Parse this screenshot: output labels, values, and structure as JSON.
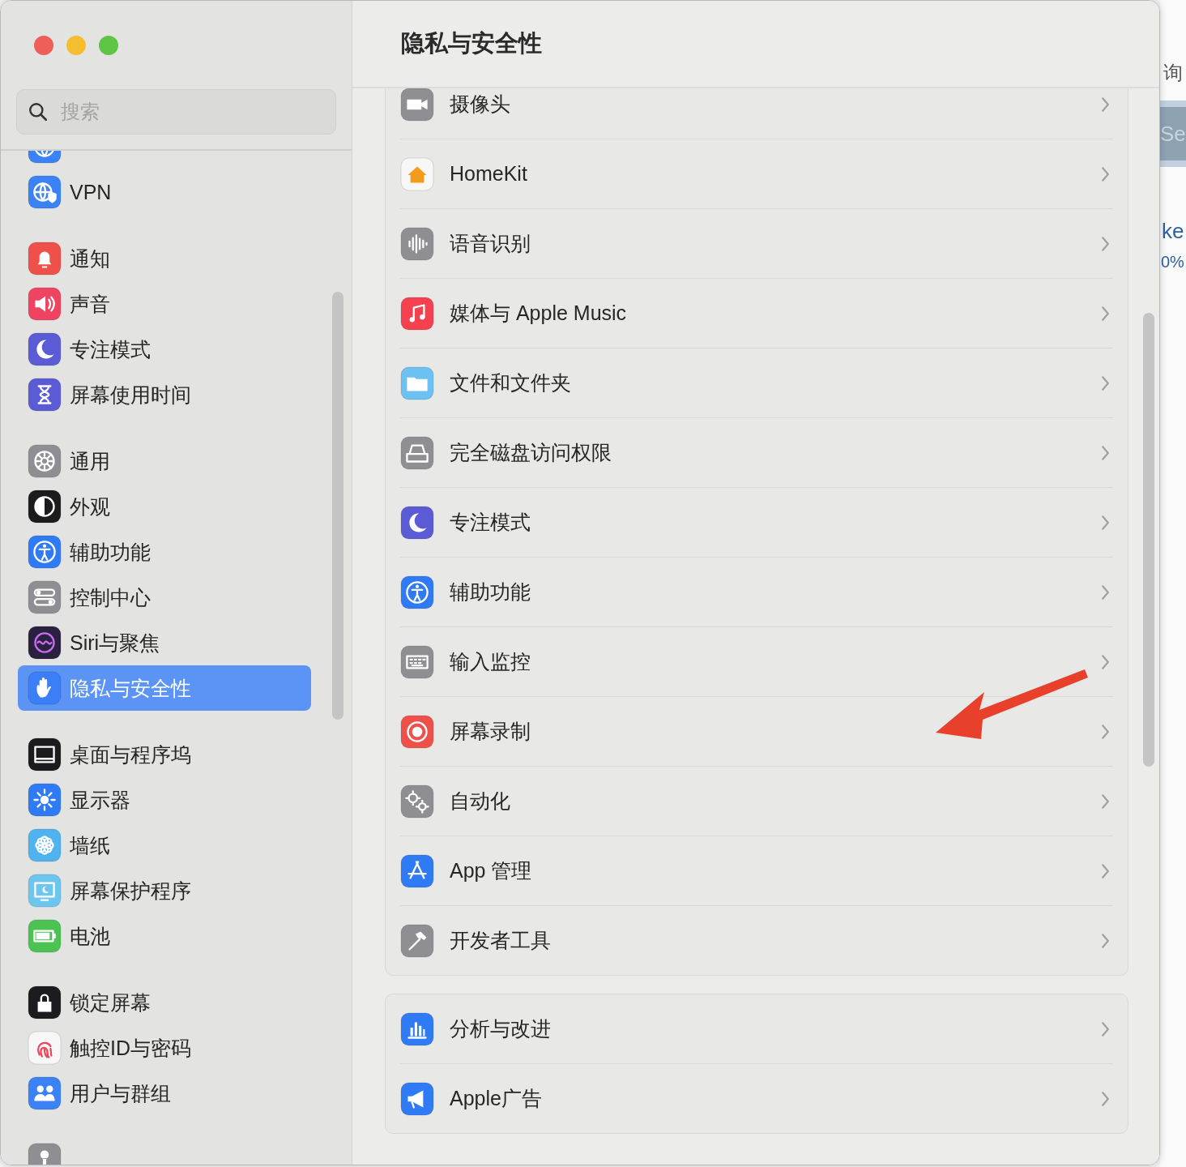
{
  "window": {
    "title": "隐私与安全性"
  },
  "search": {
    "placeholder": "搜索"
  },
  "sidebar": {
    "groups": [
      {
        "items": [
          {
            "kind": "globe",
            "color": "#3b82f6",
            "selected": false
          },
          {
            "label": "VPN",
            "kind": "vpn",
            "color": "#3b82f6",
            "selected": false
          }
        ]
      },
      {
        "items": [
          {
            "label": "通知",
            "kind": "bell",
            "color": "#f0504a",
            "selected": false
          },
          {
            "label": "声音",
            "kind": "speaker",
            "color": "#ef4461",
            "selected": false
          },
          {
            "label": "专注模式",
            "kind": "moon",
            "color": "#5b5bd6",
            "selected": false
          },
          {
            "label": "屏幕使用时间",
            "kind": "hourglass",
            "color": "#5b5bd6",
            "selected": false
          }
        ]
      },
      {
        "items": [
          {
            "label": "通用",
            "kind": "gear",
            "color": "#8e8e93",
            "selected": false
          },
          {
            "label": "外观",
            "kind": "appearance",
            "color": "#1c1c1e",
            "selected": false
          },
          {
            "label": "辅助功能",
            "kind": "accessibility",
            "color": "#2f7bf5",
            "selected": false
          },
          {
            "label": "控制中心",
            "kind": "toggles",
            "color": "#8e8e93",
            "selected": false
          },
          {
            "label": "Siri与聚焦",
            "kind": "siri",
            "color": "#2a2140",
            "selected": false
          },
          {
            "label": "隐私与安全性",
            "kind": "hand",
            "color": "#3b7ef6",
            "selected": true
          }
        ]
      },
      {
        "items": [
          {
            "label": "桌面与程序坞",
            "kind": "dock",
            "color": "#1c1c1e",
            "selected": false
          },
          {
            "label": "显示器",
            "kind": "sun",
            "color": "#2f7bf5",
            "selected": false
          },
          {
            "label": "墙纸",
            "kind": "flower",
            "color": "#4fb3f0",
            "selected": false
          },
          {
            "label": "屏幕保护程序",
            "kind": "screensaver",
            "color": "#6cc6ee",
            "selected": false
          },
          {
            "label": "电池",
            "kind": "battery",
            "color": "#4cc253",
            "selected": false
          }
        ]
      },
      {
        "items": [
          {
            "label": "锁定屏幕",
            "kind": "lock",
            "color": "#1c1c1e",
            "selected": false
          },
          {
            "label": "触控ID与密码",
            "kind": "fingerprint",
            "color": "#f7f7f7",
            "selected": false
          },
          {
            "label": "用户与群组",
            "kind": "people",
            "color": "#3b82f6",
            "selected": false
          }
        ]
      },
      {
        "items": [
          {
            "kind": "key",
            "color": "#8e8e93",
            "selected": false
          }
        ]
      }
    ]
  },
  "groups": [
    {
      "rows": [
        {
          "label": "摄像头",
          "kind": "camera",
          "color": "#8e8e93"
        },
        {
          "label": "HomeKit",
          "kind": "house",
          "color": "#f7f7f7"
        },
        {
          "label": "语音识别",
          "kind": "waveform",
          "color": "#8e8e93"
        },
        {
          "label": "媒体与 Apple Music",
          "kind": "music",
          "color": "#f5404f"
        },
        {
          "label": "文件和文件夹",
          "kind": "folder",
          "color": "#6cc0f2"
        },
        {
          "label": "完全磁盘访问权限",
          "kind": "disk",
          "color": "#8e8e93"
        },
        {
          "label": "专注模式",
          "kind": "moon",
          "color": "#5b5bd6"
        },
        {
          "label": "辅助功能",
          "kind": "accessibility",
          "color": "#2f7bf5"
        },
        {
          "label": "输入监控",
          "kind": "keyboard",
          "color": "#8e8e93"
        },
        {
          "label": "屏幕录制",
          "kind": "record",
          "color": "#f0504a"
        },
        {
          "label": "自动化",
          "kind": "gears",
          "color": "#8e8e93"
        },
        {
          "label": "App 管理",
          "kind": "appstore",
          "color": "#2f7bf5"
        },
        {
          "label": "开发者工具",
          "kind": "hammer",
          "color": "#8e8e93"
        }
      ]
    },
    {
      "rows": [
        {
          "label": "分析与改进",
          "kind": "chart",
          "color": "#2f7bf5"
        },
        {
          "label": "Apple广告",
          "kind": "megaphone",
          "color": "#2f7bf5"
        }
      ]
    }
  ],
  "background_window": {
    "texts": [
      "询",
      "Se",
      "ke",
      "0%"
    ]
  }
}
